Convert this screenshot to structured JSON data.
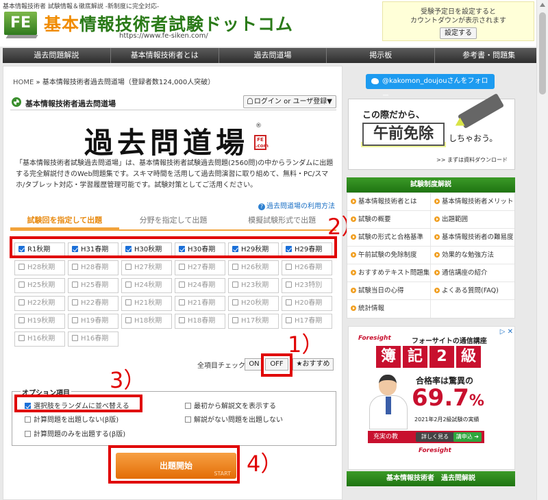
{
  "header": {
    "tagline": "基本情報技術者 試験情報＆徹底解説 -新制度に完全対応-",
    "logo_mark": "FE",
    "title_part1": "基本",
    "title_part2": "情報技術者試験ドットコム",
    "url": "https://www.fe-siken.com/",
    "countdown_line1": "受験予定日を設定すると",
    "countdown_line2": "カウントダウンが表示されます",
    "countdown_button": "設定する"
  },
  "nav": [
    "過去問題解説",
    "基本情報技術者とは",
    "過去問道場",
    "掲示板",
    "参考書・問題集"
  ],
  "breadcrumb": {
    "home": "HOME",
    "sep": "»",
    "current": "基本情報技術者過去問道場（登録者数124,000人突破）"
  },
  "section": {
    "title": "基本情報技術者過去問道場",
    "login": "ログイン or ユーザ登録▼"
  },
  "dojo": {
    "title": "過去問道場",
    "reg": "®",
    "badge": "FE .com"
  },
  "intro": "「基本情報技術者試験過去問道場」は、基本情報技術者試験過去問題(2560問)の中からランダムに出題する完全解説付きのWeb問題集です。スキマ時間を活用して過去問演習に取り組めて、無料・PC/スマホ/タブレット対応・学習履歴管理可能です。試験対策としてご活用ください。",
  "usage_link": "過去問道場の利用方法",
  "tabs": [
    "試験回を指定して出題",
    "分野を指定して出題",
    "模擬試験形式で出題"
  ],
  "exams": [
    {
      "label": "R1秋期",
      "checked": true
    },
    {
      "label": "H31春期",
      "checked": true
    },
    {
      "label": "H30秋期",
      "checked": true
    },
    {
      "label": "H30春期",
      "checked": true
    },
    {
      "label": "H29秋期",
      "checked": true
    },
    {
      "label": "H29春期",
      "checked": true
    },
    {
      "label": "H28秋期",
      "checked": false
    },
    {
      "label": "H28春期",
      "checked": false
    },
    {
      "label": "H27秋期",
      "checked": false
    },
    {
      "label": "H27春期",
      "checked": false
    },
    {
      "label": "H26秋期",
      "checked": false
    },
    {
      "label": "H26春期",
      "checked": false
    },
    {
      "label": "H25秋期",
      "checked": false
    },
    {
      "label": "H25春期",
      "checked": false
    },
    {
      "label": "H24秋期",
      "checked": false
    },
    {
      "label": "H24春期",
      "checked": false
    },
    {
      "label": "H23秋期",
      "checked": false
    },
    {
      "label": "H23特別",
      "checked": false
    },
    {
      "label": "H22秋期",
      "checked": false
    },
    {
      "label": "H22春期",
      "checked": false
    },
    {
      "label": "H21秋期",
      "checked": false
    },
    {
      "label": "H21春期",
      "checked": false
    },
    {
      "label": "H20秋期",
      "checked": false
    },
    {
      "label": "H20春期",
      "checked": false
    },
    {
      "label": "H19秋期",
      "checked": false
    },
    {
      "label": "H19春期",
      "checked": false
    },
    {
      "label": "H18秋期",
      "checked": false
    },
    {
      "label": "H18春期",
      "checked": false
    },
    {
      "label": "H17秋期",
      "checked": false
    },
    {
      "label": "H17春期",
      "checked": false
    },
    {
      "label": "H16秋期",
      "checked": false
    },
    {
      "label": "H16春期",
      "checked": false
    }
  ],
  "controls": {
    "check_all": "全項目チェック",
    "on": "ON",
    "off": "OFF",
    "recommend": "★おすすめ"
  },
  "options": {
    "legend": "オプション項目",
    "items": [
      {
        "label": "選択肢をランダムに並べ替える",
        "checked": true
      },
      {
        "label": "計算問題を出題しない(β版)",
        "checked": false
      },
      {
        "label": "計算問題のみを出題する(β版)",
        "checked": false
      },
      {
        "label": "最初から解説文を表示する",
        "checked": false
      },
      {
        "label": "解説がない問題を出題しない",
        "checked": false
      }
    ]
  },
  "start": {
    "label": "出題開始",
    "sub": "START"
  },
  "annotations": [
    "1）",
    "2）",
    "3）",
    "4）"
  ],
  "sidebar": {
    "twitter": "@kakomon_doujouさんをフォロー",
    "banner_l1": "この際だから、",
    "banner_main": "午前免除",
    "banner_tail": "しちゃおう。",
    "banner_dl": ">> まずは資料ダウンロード",
    "menu_title": "試験制度解説",
    "menu": [
      [
        "基本情報技術者とは",
        "基本情報技術者メリット"
      ],
      [
        "試験の概要",
        "出題範囲"
      ],
      [
        "試験の形式と合格基準",
        "基本情報技術者の難易度"
      ],
      [
        "午前試験の免除制度",
        "効果的な勉強方法"
      ],
      [
        "おすすめテキスト問題集",
        "通信講座の紹介"
      ],
      [
        "試験当日の心得",
        "よくある質問(FAQ)"
      ],
      [
        "統計情報",
        ""
      ]
    ],
    "ad": {
      "choice": "▷ ✕",
      "brand": "Foresight",
      "head": "フォーサイトの通信講座",
      "boki": [
        "簿",
        "記",
        "2",
        "級"
      ],
      "rate_label": "合格率は驚異の",
      "rate": "69.7",
      "rate_unit": "%",
      "result": "2021年2月2級試験の実績",
      "bar": "充実の教",
      "more": "詳しく見る",
      "apply": "講申込 ➔",
      "foot": "Foresight"
    },
    "menu2_title": "基本情報技術者　過去問解説"
  }
}
